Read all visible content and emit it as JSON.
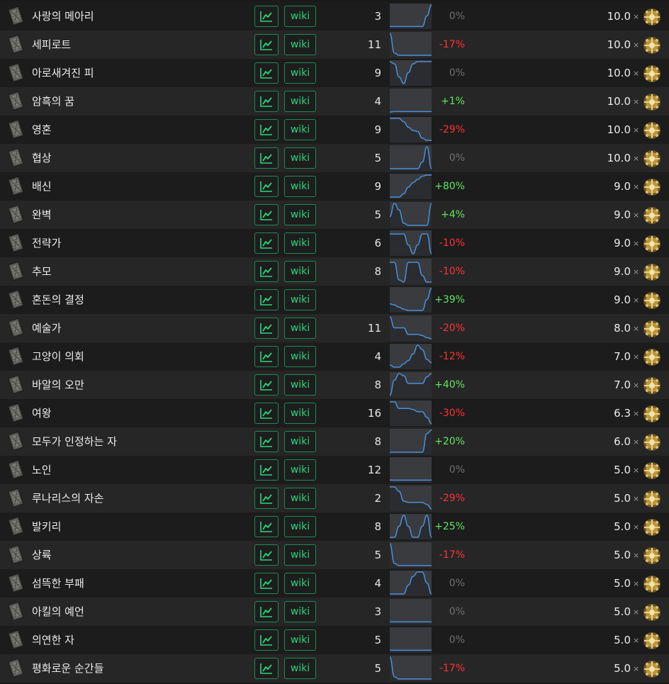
{
  "ui": {
    "graph_icon": "line-chart-icon",
    "card_icon": "divination-card-icon",
    "currency_icon": "exalted-orb-icon",
    "times_symbol": "×",
    "wiki_label": "wiki",
    "colors": {
      "button_accent": "#2bd67f",
      "positive": "#5ee65e",
      "negative": "#ff3333",
      "neutral": "#6f6f6f",
      "sparkline": "#4a90d9"
    }
  },
  "rows": [
    {
      "name": "사랑의 메아리",
      "count": "3",
      "spark": [
        0.02,
        0.02,
        0.02,
        0.02,
        0.02,
        0.02,
        0.02,
        0.02,
        0.5,
        1.0
      ],
      "change": "0%",
      "sign": "zero",
      "price": "10.0"
    },
    {
      "name": "세피로트",
      "count": "11",
      "spark": [
        1.0,
        0.1,
        0.0,
        0.0,
        0.0,
        0.0,
        0.0,
        0.0,
        0.0,
        0.0
      ],
      "change": "-17%",
      "sign": "neg",
      "price": "10.0"
    },
    {
      "name": "아로새겨진 피",
      "count": "9",
      "spark": [
        1.0,
        0.9,
        0.3,
        0.0,
        0.5,
        0.9,
        1.0,
        1.0,
        1.0,
        1.0
      ],
      "change": "0%",
      "sign": "zero",
      "price": "10.0"
    },
    {
      "name": "암흑의 꿈",
      "count": "4",
      "spark": [
        0.0,
        0.02,
        0.02,
        0.02,
        0.02,
        0.02,
        0.02,
        0.02,
        0.02,
        0.02
      ],
      "change": "+1%",
      "sign": "pos",
      "price": "10.0"
    },
    {
      "name": "영혼",
      "count": "9",
      "spark": [
        1.0,
        1.0,
        1.0,
        0.85,
        0.6,
        0.45,
        0.4,
        0.1,
        0.0,
        0.0
      ],
      "change": "-29%",
      "sign": "neg",
      "price": "10.0"
    },
    {
      "name": "협상",
      "count": "5",
      "spark": [
        0.0,
        0.0,
        0.0,
        0.0,
        0.0,
        0.0,
        0.0,
        0.3,
        1.0,
        0.0
      ],
      "change": "0%",
      "sign": "zero",
      "price": "10.0"
    },
    {
      "name": "배신",
      "count": "9",
      "spark": [
        0.0,
        0.0,
        0.0,
        0.15,
        0.45,
        0.65,
        0.8,
        0.95,
        1.0,
        1.0
      ],
      "change": "+80%",
      "sign": "pos",
      "price": "9.0"
    },
    {
      "name": "완벽",
      "count": "5",
      "spark": [
        0.4,
        1.0,
        0.7,
        0.1,
        0.0,
        0.0,
        0.0,
        0.0,
        0.0,
        1.0
      ],
      "change": "+4%",
      "sign": "pos",
      "price": "9.0"
    },
    {
      "name": "전략가",
      "count": "6",
      "spark": [
        0.9,
        0.9,
        0.9,
        0.9,
        0.4,
        0.0,
        0.4,
        0.9,
        0.9,
        0.0
      ],
      "change": "-10%",
      "sign": "neg",
      "price": "9.0"
    },
    {
      "name": "추모",
      "count": "8",
      "spark": [
        0.9,
        0.9,
        0.1,
        0.0,
        0.9,
        0.9,
        0.9,
        0.3,
        0.0,
        0.0
      ],
      "change": "-10%",
      "sign": "neg",
      "price": "9.0"
    },
    {
      "name": "혼돈의 결정",
      "count": "",
      "spark": [
        0.3,
        0.25,
        0.15,
        0.05,
        0.0,
        0.0,
        0.0,
        0.0,
        0.5,
        1.0
      ],
      "change": "+39%",
      "sign": "pos",
      "price": "9.0"
    },
    {
      "name": "예술가",
      "count": "11",
      "spark": [
        1.0,
        0.5,
        0.5,
        0.5,
        0.2,
        0.2,
        0.2,
        0.15,
        0.05,
        0.0
      ],
      "change": "-20%",
      "sign": "neg",
      "price": "8.0"
    },
    {
      "name": "고양이 의회",
      "count": "4",
      "spark": [
        0.1,
        0.0,
        0.0,
        0.15,
        0.3,
        0.6,
        1.0,
        0.8,
        0.35,
        0.2
      ],
      "change": "-12%",
      "sign": "neg",
      "price": "7.0"
    },
    {
      "name": "바알의 오만",
      "count": "8",
      "spark": [
        0.0,
        0.7,
        1.0,
        0.9,
        0.55,
        0.55,
        0.55,
        0.55,
        0.85,
        1.0
      ],
      "change": "+40%",
      "sign": "pos",
      "price": "7.0"
    },
    {
      "name": "여왕",
      "count": "16",
      "spark": [
        1.0,
        1.0,
        0.7,
        0.7,
        0.7,
        0.65,
        0.55,
        0.55,
        0.3,
        0.0
      ],
      "change": "-30%",
      "sign": "neg",
      "price": "6.3"
    },
    {
      "name": "모두가 인정하는 자",
      "count": "8",
      "spark": [
        0.0,
        0.0,
        0.0,
        0.0,
        0.0,
        0.0,
        0.0,
        0.0,
        0.85,
        1.0
      ],
      "change": "+20%",
      "sign": "pos",
      "price": "6.0"
    },
    {
      "name": "노인",
      "count": "12",
      "spark": [
        0.02,
        0.02,
        0.02,
        0.02,
        0.02,
        0.02,
        0.02,
        0.02,
        0.02,
        0.02
      ],
      "change": "0%",
      "sign": "zero",
      "price": "5.0"
    },
    {
      "name": "루나리스의 자손",
      "count": "2",
      "spark": [
        1.0,
        1.0,
        0.8,
        0.35,
        0.3,
        0.3,
        0.3,
        0.3,
        0.2,
        0.0
      ],
      "change": "-29%",
      "sign": "neg",
      "price": "5.0"
    },
    {
      "name": "발키리",
      "count": "8",
      "spark": [
        0.0,
        0.0,
        0.5,
        1.0,
        0.5,
        0.0,
        0.0,
        0.5,
        1.0,
        0.0
      ],
      "change": "+25%",
      "sign": "pos",
      "price": "5.0"
    },
    {
      "name": "상륙",
      "count": "5",
      "spark": [
        1.0,
        0.1,
        0.0,
        0.0,
        0.0,
        0.0,
        0.0,
        0.0,
        0.0,
        0.0
      ],
      "change": "-17%",
      "sign": "neg",
      "price": "5.0"
    },
    {
      "name": "섬뜩한 부패",
      "count": "4",
      "spark": [
        0.0,
        0.0,
        0.0,
        0.0,
        0.4,
        0.8,
        1.0,
        1.0,
        0.5,
        0.0
      ],
      "change": "0%",
      "sign": "zero",
      "price": "5.0"
    },
    {
      "name": "아킬의 예언",
      "count": "3",
      "spark": [
        0.02,
        0.02,
        0.02,
        0.02,
        0.02,
        0.02,
        0.02,
        0.02,
        0.02,
        0.02
      ],
      "change": "0%",
      "sign": "zero",
      "price": "5.0"
    },
    {
      "name": "의연한 자",
      "count": "5",
      "spark": [
        0.02,
        0.02,
        0.02,
        0.02,
        0.02,
        0.02,
        0.02,
        0.02,
        0.02,
        0.02
      ],
      "change": "0%",
      "sign": "zero",
      "price": "5.0"
    },
    {
      "name": "평화로운 순간들",
      "count": "5",
      "spark": [
        1.0,
        0.1,
        0.0,
        0.0,
        0.0,
        0.0,
        0.0,
        0.0,
        0.0,
        0.0
      ],
      "change": "-17%",
      "sign": "neg",
      "price": "5.0"
    }
  ]
}
